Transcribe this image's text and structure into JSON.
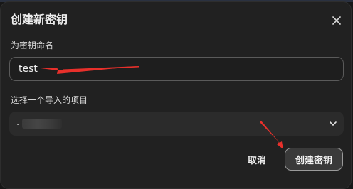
{
  "dialog": {
    "title": "创建新密钥",
    "close_icon": "close-icon",
    "name_label": "为密钥命名",
    "name_value": "test",
    "project_label": "选择一个导入的项目",
    "project_value": ".",
    "select_icon": "chevron-down-icon",
    "cancel_label": "取消",
    "create_label": "创建密钥"
  },
  "annotations": {
    "arrow_color": "#e8302b"
  }
}
